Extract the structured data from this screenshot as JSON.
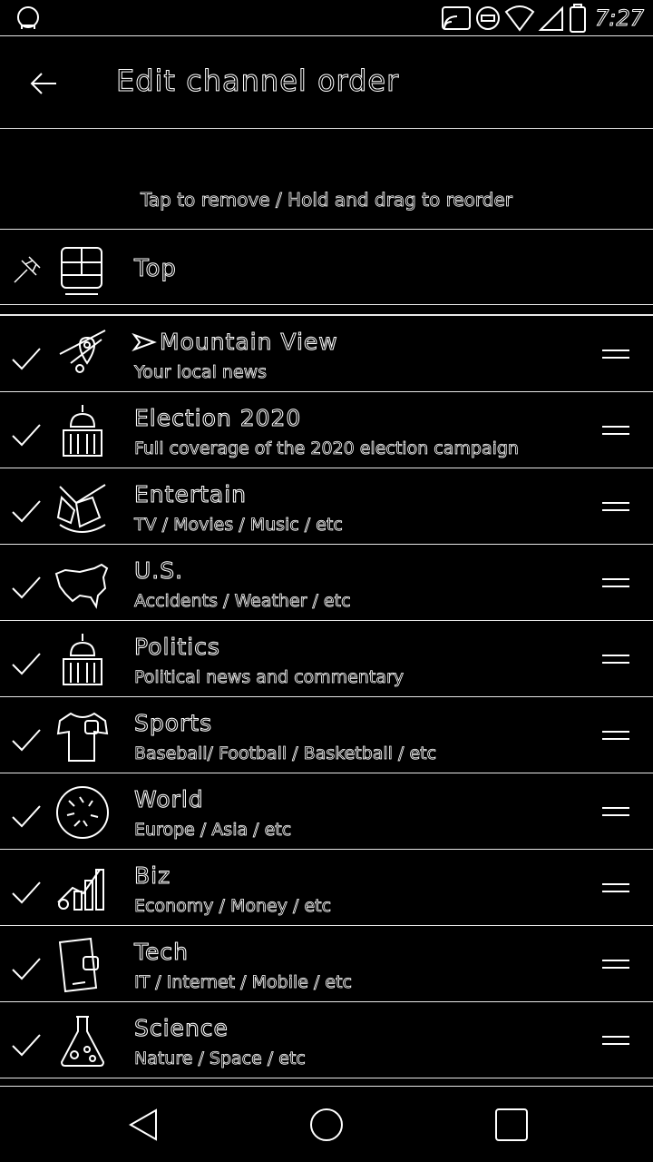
{
  "status_bar": {
    "time": "7:27",
    "icons": [
      "notification-icon",
      "cast-icon",
      "do-not-disturb-icon",
      "wifi-icon",
      "signal-icon",
      "battery-icon"
    ]
  },
  "header": {
    "title": "Edit channel order",
    "back_icon": "arrow-back-icon"
  },
  "instruction": "Tap to remove / Hold and drag to reorder",
  "top_channel": {
    "title": "Top",
    "icon": "newspaper-icon",
    "lead_icon": "pin-icon"
  },
  "channels": [
    {
      "title": "Mountain View",
      "subtitle": "Your local news",
      "icon": "map-pin-icon",
      "title_prefix_icon": "location-arrow-icon"
    },
    {
      "title": "Election 2020",
      "subtitle": "Full coverage of the 2020 election campaign",
      "icon": "capitol-icon"
    },
    {
      "title": "Entertain",
      "subtitle": "TV / Movies / Music / etc",
      "icon": "clapperboard-icon"
    },
    {
      "title": "U.S.",
      "subtitle": "Accidents / Weather / etc",
      "icon": "usa-map-icon"
    },
    {
      "title": "Politics",
      "subtitle": "Political news and commentary",
      "icon": "capitol-icon"
    },
    {
      "title": "Sports",
      "subtitle": "Baseball/ Football / Basketball / etc",
      "icon": "jersey-icon"
    },
    {
      "title": "World",
      "subtitle": "Europe / Asia / etc",
      "icon": "globe-icon"
    },
    {
      "title": "Biz",
      "subtitle": "Economy / Money / etc",
      "icon": "bar-chart-icon"
    },
    {
      "title": "Tech",
      "subtitle": "IT / Internet / Mobile / etc",
      "icon": "smartphone-icon"
    },
    {
      "title": "Science",
      "subtitle": "Nature / Space / etc",
      "icon": "flask-icon"
    }
  ],
  "nav_bar": {
    "buttons": [
      "back-triangle-icon",
      "home-circle-icon",
      "recents-square-icon"
    ]
  },
  "colors": {
    "background": "#000000",
    "outline": "#ffffff"
  }
}
